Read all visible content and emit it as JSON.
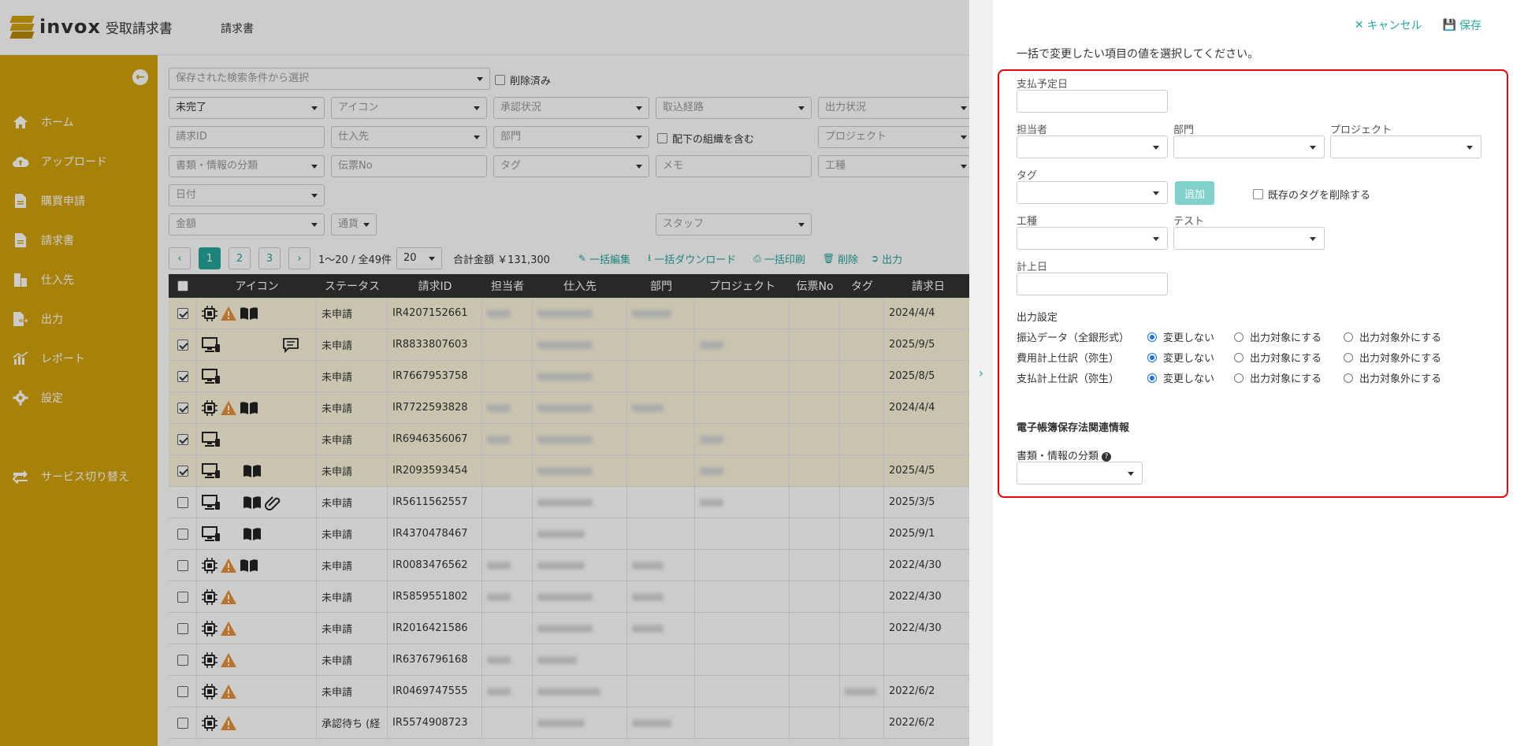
{
  "app": {
    "brand": "invox",
    "product": "受取請求書",
    "nav_current": "請求書"
  },
  "sidebar": {
    "items": [
      {
        "label": "ホーム",
        "icon": "home-icon"
      },
      {
        "label": "アップロード",
        "icon": "upload-cloud-icon"
      },
      {
        "label": "購買申請",
        "icon": "document-icon"
      },
      {
        "label": "請求書",
        "icon": "document-icon"
      },
      {
        "label": "仕入先",
        "icon": "building-icon"
      },
      {
        "label": "出力",
        "icon": "export-icon"
      },
      {
        "label": "レポート",
        "icon": "chart-icon"
      },
      {
        "label": "設定",
        "icon": "gear-icon"
      },
      {
        "label": "サービス切り替え",
        "icon": "switch-icon"
      }
    ]
  },
  "filters": {
    "saved_search": "保存された検索条件から選択",
    "deleted": "削除済み",
    "status": "未完了",
    "icon": "アイコン",
    "approval": "承認状況",
    "route": "取込経路",
    "output": "出力状況",
    "invoice_id": "請求ID",
    "supplier": "仕入先",
    "department": "部門",
    "include_sub": "配下の組織を含む",
    "project": "プロジェクト",
    "doc_class": "書類・情報の分類",
    "voucher": "伝票No",
    "tag": "タグ",
    "memo": "メモ",
    "work_type": "工種",
    "date": "日付",
    "amount": "金額",
    "currency": "通貨",
    "staff": "スタッフ"
  },
  "pager": {
    "pages": [
      "1",
      "2",
      "3"
    ],
    "range": "1〜20 / 全49件",
    "per_page": "20",
    "total": "合計金額 ￥131,300",
    "actions": [
      "一括編集",
      "一括ダウンロード",
      "一括印刷",
      "削除",
      "出力"
    ]
  },
  "table": {
    "headers": [
      "アイコン",
      "ステータス",
      "請求ID",
      "担当者",
      "仕入先",
      "部門",
      "プロジェクト",
      "伝票No",
      "タグ",
      "請求日"
    ],
    "rows": [
      {
        "checked": true,
        "status": "未申請",
        "id": "IR4207152661",
        "date": "2024/4/4"
      },
      {
        "checked": true,
        "status": "未申請",
        "id": "IR8833807603",
        "date": "2025/9/5"
      },
      {
        "checked": true,
        "status": "未申請",
        "id": "IR7667953758",
        "date": "2025/8/5"
      },
      {
        "checked": true,
        "status": "未申請",
        "id": "IR7722593828",
        "date": "2024/4/4"
      },
      {
        "checked": true,
        "status": "未申請",
        "id": "IR6946356067",
        "date": ""
      },
      {
        "checked": true,
        "status": "未申請",
        "id": "IR2093593454",
        "date": "2025/4/5"
      },
      {
        "checked": false,
        "status": "未申請",
        "id": "IR5611562557",
        "date": "2025/3/5"
      },
      {
        "checked": false,
        "status": "未申請",
        "id": "IR4370478467",
        "date": "2025/9/1"
      },
      {
        "checked": false,
        "status": "未申請",
        "id": "IR0083476562",
        "date": "2022/4/30"
      },
      {
        "checked": false,
        "status": "未申請",
        "id": "IR5859551802",
        "date": "2022/4/30"
      },
      {
        "checked": false,
        "status": "未申請",
        "id": "IR2016421586",
        "date": "2022/4/30"
      },
      {
        "checked": false,
        "status": "未申請",
        "id": "IR6376796168",
        "date": ""
      },
      {
        "checked": false,
        "status": "未申請",
        "id": "IR0469747555",
        "date": "2022/6/2"
      },
      {
        "checked": false,
        "status": "承認待ち (経",
        "id": "IR5574908723",
        "date": "2022/6/2"
      }
    ]
  },
  "panel": {
    "cancel": "キャンセル",
    "save": "保存",
    "description": "一括で変更したい項目の値を選択してください。",
    "payment_date": "支払予定日",
    "person": "担当者",
    "department": "部門",
    "project": "プロジェクト",
    "tag": "タグ",
    "add": "追加",
    "remove_tags": "既存のタグを削除する",
    "work_type": "工種",
    "test": "テスト",
    "posting_date": "計上日",
    "output_settings": "出力設定",
    "output_rows": [
      "振込データ（全銀形式）",
      "費用計上仕訳（弥生）",
      "支払計上仕訳（弥生）"
    ],
    "options": [
      "変更しない",
      "出力対象にする",
      "出力対象外にする"
    ],
    "ebook_title": "電子帳簿保存法関連情報",
    "doc_class": "書類・情報の分類"
  }
}
